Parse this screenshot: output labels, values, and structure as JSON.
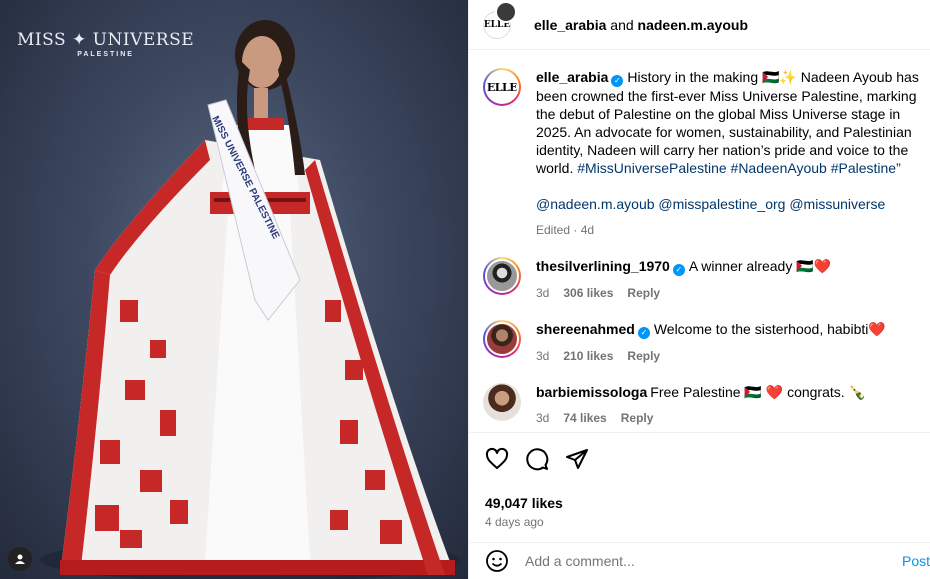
{
  "photo": {
    "logo_main": "MISS ✦ UNIVERSE",
    "logo_sub": "PALESTINE",
    "sash_text": "MISS UNIVERSE PALESTINE"
  },
  "header": {
    "account_a": "elle_arabia",
    "joiner": " and ",
    "account_b": "nadeen.m.ayoub",
    "elle_logo": "ELLE"
  },
  "caption": {
    "username": "elle_arabia",
    "text": "History in the making 🇵🇸✨ Nadeen Ayoub has been crowned the first-ever Miss Universe Palestine, marking the debut of Palestine on the global Miss Universe stage in 2025. An advocate for women, sustainability, and Palestinian identity, Nadeen will carry her nation’s pride and voice to the world.",
    "hashtags": "#MissUniversePalestine #NadeenAyoub #Palestine”",
    "mentions": "@nadeen.m.ayoub @misspalestine_org @missuniverse",
    "edited": "Edited · 4d"
  },
  "comments": [
    {
      "username": "thesilverlining_1970",
      "verified": true,
      "text": "A winner already 🇵🇸❤️",
      "time": "3d",
      "likes": "306 likes",
      "reply": "Reply"
    },
    {
      "username": "shereenahmed",
      "verified": true,
      "text": "Welcome to the sisterhood, habibti❤️",
      "time": "3d",
      "likes": "210 likes",
      "reply": "Reply"
    },
    {
      "username": "barbiemissologa",
      "verified": false,
      "text": "Free Palestine 🇵🇸 ❤️ congrats. 🍾",
      "time": "3d",
      "likes": "74 likes",
      "reply": "Reply"
    }
  ],
  "actions": {
    "likes": "49,047 likes",
    "age": "4 days ago"
  },
  "comment_box": {
    "placeholder": "Add a comment...",
    "post_label": "Post"
  },
  "colors": {
    "link": "#00376b",
    "verified": "#0095f6",
    "muted": "#737373",
    "photo_bg": "#3d4860"
  }
}
